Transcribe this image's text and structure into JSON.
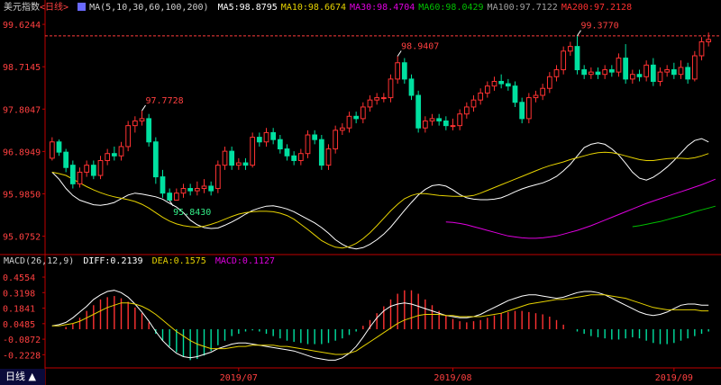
{
  "header": {
    "instrument": "美元指数",
    "period_tag": "<日线>",
    "ma_params": "MA(5,10,30,60,100,200)",
    "ma_values": [
      {
        "label": "MA5:98.8795",
        "color": "#ffffff"
      },
      {
        "label": "MA10:98.6674",
        "color": "#e6d200"
      },
      {
        "label": "MA30:98.4704",
        "color": "#e000e0"
      },
      {
        "label": "MA60:98.0429",
        "color": "#00c000"
      },
      {
        "label": "MA100:97.7122",
        "color": "#a0a0a0"
      },
      {
        "label": "MA200:97.2128",
        "color": "#ff3030"
      }
    ]
  },
  "macd_header": {
    "title": "MACD(26,12,9)",
    "diff": "DIFF:0.2139",
    "dea": "DEA:0.1575",
    "macd": "MACD:0.1127"
  },
  "period_button": "日线 ▲",
  "colors": {
    "up": "#ff3232",
    "down": "#00e0a0",
    "axis": "#c00000",
    "label": "#ff4040",
    "dash": "#ff3c3c"
  },
  "chart_data": [
    {
      "type": "candlestick",
      "y_ticks": [
        "99.6244",
        "98.7145",
        "97.8047",
        "96.8949",
        "95.9850",
        "95.0752"
      ],
      "ylim": [
        94.7,
        99.8
      ],
      "annotations": {
        "high1": "97.7728",
        "low1": "95.8430",
        "high2": "98.9407",
        "high3": "99.3770"
      },
      "resistance_line": 99.377,
      "x_labels": [
        "2019/07",
        "2019/08",
        "2019/09"
      ],
      "x_label_index": [
        27,
        58,
        90
      ],
      "candles": [
        [
          96.75,
          97.1,
          97.2,
          96.7
        ],
        [
          97.1,
          96.88,
          97.15,
          96.8
        ],
        [
          96.88,
          96.55,
          96.95,
          96.45
        ],
        [
          96.6,
          96.2,
          96.7,
          96.1
        ],
        [
          96.2,
          96.45,
          96.55,
          96.12
        ],
        [
          96.45,
          96.6,
          96.7,
          96.35
        ],
        [
          96.6,
          96.38,
          96.7,
          96.3
        ],
        [
          96.38,
          96.7,
          96.8,
          96.3
        ],
        [
          96.7,
          96.85,
          96.95,
          96.6
        ],
        [
          96.85,
          96.8,
          97.0,
          96.7
        ],
        [
          96.8,
          97.0,
          97.1,
          96.7
        ],
        [
          97.0,
          97.45,
          97.55,
          96.9
        ],
        [
          97.45,
          97.55,
          97.65,
          97.3
        ],
        [
          97.55,
          97.6,
          97.77,
          97.45
        ],
        [
          97.6,
          97.1,
          97.7,
          97.0
        ],
        [
          97.1,
          96.35,
          97.2,
          96.2
        ],
        [
          96.35,
          96.0,
          96.5,
          95.9
        ],
        [
          96.0,
          95.85,
          96.1,
          95.84
        ],
        [
          95.85,
          96.0,
          96.1,
          95.84
        ],
        [
          96.0,
          96.1,
          96.2,
          95.9
        ],
        [
          96.1,
          96.05,
          96.2,
          95.95
        ],
        [
          96.05,
          96.1,
          96.25,
          95.95
        ],
        [
          96.1,
          96.15,
          96.3,
          96.0
        ],
        [
          96.15,
          96.05,
          96.25,
          95.95
        ],
        [
          96.1,
          96.6,
          96.7,
          96.0
        ],
        [
          96.6,
          96.9,
          97.0,
          96.5
        ],
        [
          96.9,
          96.6,
          97.0,
          96.5
        ],
        [
          96.6,
          96.65,
          96.75,
          96.5
        ],
        [
          96.65,
          96.6,
          96.75,
          96.5
        ],
        [
          96.6,
          97.2,
          97.3,
          96.55
        ],
        [
          97.2,
          97.1,
          97.3,
          97.0
        ],
        [
          97.1,
          97.3,
          97.4,
          97.0
        ],
        [
          97.3,
          97.15,
          97.4,
          97.05
        ],
        [
          97.15,
          96.95,
          97.25,
          96.85
        ],
        [
          96.95,
          96.8,
          97.05,
          96.7
        ],
        [
          96.8,
          96.7,
          96.9,
          96.6
        ],
        [
          96.7,
          96.85,
          96.95,
          96.6
        ],
        [
          96.85,
          97.25,
          97.35,
          96.75
        ],
        [
          97.25,
          97.15,
          97.35,
          97.05
        ],
        [
          97.15,
          96.6,
          97.25,
          96.5
        ],
        [
          96.6,
          96.95,
          97.05,
          96.5
        ],
        [
          96.95,
          97.35,
          97.45,
          96.85
        ],
        [
          97.35,
          97.4,
          97.5,
          97.25
        ],
        [
          97.4,
          97.65,
          97.75,
          97.3
        ],
        [
          97.65,
          97.6,
          97.75,
          97.5
        ],
        [
          97.6,
          97.85,
          97.95,
          97.5
        ],
        [
          97.85,
          98.0,
          98.1,
          97.75
        ],
        [
          98.0,
          98.05,
          98.15,
          97.9
        ],
        [
          98.05,
          98.05,
          98.15,
          97.95
        ],
        [
          98.05,
          98.45,
          98.55,
          97.95
        ],
        [
          98.45,
          98.8,
          98.94,
          98.35
        ],
        [
          98.8,
          98.45,
          98.9,
          98.35
        ],
        [
          98.45,
          98.1,
          98.55,
          98.0
        ],
        [
          98.1,
          97.4,
          98.2,
          97.3
        ],
        [
          97.4,
          97.55,
          97.65,
          97.3
        ],
        [
          97.55,
          97.6,
          97.7,
          97.45
        ],
        [
          97.6,
          97.55,
          97.7,
          97.45
        ],
        [
          97.55,
          97.45,
          97.65,
          97.35
        ],
        [
          97.45,
          97.45,
          97.6,
          97.35
        ],
        [
          97.45,
          97.7,
          97.8,
          97.35
        ],
        [
          97.7,
          97.85,
          97.95,
          97.6
        ],
        [
          97.85,
          98.0,
          98.1,
          97.75
        ],
        [
          98.0,
          98.15,
          98.25,
          97.9
        ],
        [
          98.15,
          98.3,
          98.4,
          98.05
        ],
        [
          98.3,
          98.4,
          98.5,
          98.2
        ],
        [
          98.4,
          98.35,
          98.55,
          98.25
        ],
        [
          98.35,
          98.3,
          98.45,
          98.2
        ],
        [
          98.3,
          97.95,
          98.4,
          97.85
        ],
        [
          97.95,
          97.6,
          98.05,
          97.5
        ],
        [
          97.6,
          98.05,
          98.15,
          97.5
        ],
        [
          98.05,
          98.1,
          98.2,
          97.95
        ],
        [
          98.1,
          98.25,
          98.35,
          98.0
        ],
        [
          98.25,
          98.5,
          98.6,
          98.15
        ],
        [
          98.5,
          98.65,
          98.75,
          98.4
        ],
        [
          98.65,
          99.05,
          99.15,
          98.55
        ],
        [
          99.05,
          99.15,
          99.25,
          98.95
        ],
        [
          99.15,
          98.65,
          99.38,
          98.55
        ],
        [
          98.65,
          98.55,
          98.75,
          98.45
        ],
        [
          98.55,
          98.6,
          98.7,
          98.45
        ],
        [
          98.6,
          98.55,
          98.7,
          98.45
        ],
        [
          98.55,
          98.65,
          98.75,
          98.45
        ],
        [
          98.65,
          98.6,
          98.75,
          98.5
        ],
        [
          98.6,
          98.9,
          99.0,
          98.5
        ],
        [
          98.9,
          98.45,
          99.2,
          98.35
        ],
        [
          98.45,
          98.55,
          98.65,
          98.35
        ],
        [
          98.55,
          98.5,
          98.65,
          98.4
        ],
        [
          98.5,
          98.75,
          98.85,
          98.4
        ],
        [
          98.75,
          98.4,
          98.9,
          98.3
        ],
        [
          98.4,
          98.6,
          98.7,
          98.3
        ],
        [
          98.6,
          98.65,
          98.75,
          98.5
        ],
        [
          98.65,
          98.55,
          98.8,
          98.45
        ],
        [
          98.55,
          98.7,
          98.85,
          98.45
        ],
        [
          98.7,
          98.45,
          98.8,
          98.35
        ],
        [
          98.45,
          98.95,
          99.05,
          98.4
        ],
        [
          98.95,
          99.25,
          99.35,
          98.85
        ],
        [
          99.25,
          99.3,
          99.45,
          99.15
        ]
      ],
      "lines": {
        "ma5": [
          96.45,
          96.3,
          96.1,
          95.95,
          95.85,
          95.8,
          95.75,
          95.74,
          95.76,
          95.8,
          95.88,
          95.96,
          96.0,
          95.98,
          95.95,
          95.92,
          95.87,
          95.78,
          95.7,
          95.58,
          95.42,
          95.32,
          95.26,
          95.24,
          95.25,
          95.31,
          95.38,
          95.46,
          95.55,
          95.63,
          95.68,
          95.72,
          95.73,
          95.7,
          95.66,
          95.6,
          95.52,
          95.44,
          95.36,
          95.26,
          95.14,
          95.0,
          94.9,
          94.83,
          94.8,
          94.83,
          94.9,
          95.0,
          95.12,
          95.27,
          95.45,
          95.63,
          95.8,
          95.96,
          96.08,
          96.16,
          96.18,
          96.15,
          96.07,
          95.97,
          95.9,
          95.87,
          95.86,
          95.86,
          95.87,
          95.9,
          95.96,
          96.03,
          96.09,
          96.14,
          96.18,
          96.22,
          96.28,
          96.36,
          96.48,
          96.62,
          96.8,
          96.98,
          97.05,
          97.08,
          97.05,
          96.95,
          96.82,
          96.64,
          96.45,
          96.32,
          96.28,
          96.34,
          96.44,
          96.56,
          96.7,
          96.86,
          97.02,
          97.13,
          97.17,
          97.1
        ],
        "ma10": [
          96.45,
          96.42,
          96.38,
          96.3,
          96.22,
          96.14,
          96.07,
          96.01,
          95.96,
          95.92,
          95.89,
          95.86,
          95.82,
          95.76,
          95.68,
          95.58,
          95.48,
          95.4,
          95.34,
          95.3,
          95.28,
          95.27,
          95.29,
          95.33,
          95.38,
          95.44,
          95.5,
          95.55,
          95.58,
          95.6,
          95.61,
          95.61,
          95.6,
          95.57,
          95.52,
          95.44,
          95.33,
          95.22,
          95.1,
          94.98,
          94.9,
          94.84,
          94.82,
          94.85,
          94.92,
          95.02,
          95.15,
          95.3,
          95.46,
          95.62,
          95.76,
          95.88,
          95.95,
          95.99,
          95.99,
          95.97,
          95.95,
          95.94,
          95.93,
          95.93,
          95.93,
          95.95,
          96.0,
          96.06,
          96.12,
          96.18,
          96.24,
          96.3,
          96.36,
          96.42,
          96.48,
          96.54,
          96.59,
          96.63,
          96.67,
          96.72,
          96.76,
          96.8,
          96.84,
          96.87,
          96.88,
          96.87,
          96.84,
          96.8,
          96.76,
          96.72,
          96.7,
          96.7,
          96.72,
          96.74,
          96.75,
          96.75,
          96.74,
          96.76,
          96.8,
          96.85
        ]
      },
      "ma30_line": [
        95.38,
        95.37,
        95.35,
        95.32,
        95.28,
        95.24,
        95.2,
        95.16,
        95.12,
        95.08,
        95.06,
        95.04,
        95.03,
        95.03,
        95.04,
        95.06,
        95.08,
        95.12,
        95.16,
        95.2,
        95.25,
        95.3,
        95.36,
        95.42,
        95.48,
        95.54,
        95.6,
        95.66,
        95.72,
        95.78,
        95.83,
        95.88,
        95.93,
        95.98,
        96.03,
        96.08,
        96.13,
        96.18,
        96.24,
        96.3
      ],
      "ma60_line": [
        95.28,
        95.3,
        95.33,
        95.36,
        95.39,
        95.43,
        95.47,
        95.51,
        95.55,
        95.6,
        95.64,
        95.68,
        95.72
      ],
      "ma30_start_index": 57,
      "ma60_start_index": 84
    },
    {
      "type": "macd",
      "y_ticks": [
        "0.4554",
        "0.3198",
        "0.1841",
        "0.0485",
        "-0.0872",
        "-0.2228"
      ],
      "ylim": [
        -0.33,
        0.55
      ],
      "histogram": [
        0.0,
        0.0,
        0.02,
        0.05,
        0.1,
        0.16,
        0.21,
        0.26,
        0.28,
        0.29,
        0.27,
        0.24,
        0.19,
        0.14,
        0.06,
        -0.04,
        -0.1,
        -0.15,
        -0.2,
        -0.24,
        -0.27,
        -0.26,
        -0.23,
        -0.19,
        -0.14,
        -0.1,
        -0.06,
        -0.04,
        -0.02,
        -0.01,
        -0.02,
        -0.04,
        -0.06,
        -0.08,
        -0.1,
        -0.11,
        -0.12,
        -0.13,
        -0.13,
        -0.13,
        -0.12,
        -0.1,
        -0.08,
        -0.05,
        -0.02,
        0.03,
        0.08,
        0.14,
        0.2,
        0.26,
        0.31,
        0.34,
        0.34,
        0.31,
        0.26,
        0.21,
        0.16,
        0.12,
        0.09,
        0.07,
        0.06,
        0.07,
        0.08,
        0.1,
        0.12,
        0.14,
        0.15,
        0.16,
        0.16,
        0.15,
        0.14,
        0.13,
        0.11,
        0.08,
        0.04,
        0.0,
        -0.02,
        -0.04,
        -0.06,
        -0.07,
        -0.08,
        -0.09,
        -0.09,
        -0.08,
        -0.07,
        -0.08,
        -0.1,
        -0.12,
        -0.13,
        -0.13,
        -0.12,
        -0.1,
        -0.08,
        -0.06,
        -0.04,
        -0.02
      ],
      "diff": [
        0.03,
        0.04,
        0.06,
        0.1,
        0.15,
        0.2,
        0.26,
        0.3,
        0.33,
        0.34,
        0.32,
        0.28,
        0.22,
        0.15,
        0.07,
        -0.02,
        -0.1,
        -0.16,
        -0.21,
        -0.24,
        -0.25,
        -0.24,
        -0.22,
        -0.2,
        -0.17,
        -0.15,
        -0.13,
        -0.12,
        -0.12,
        -0.13,
        -0.14,
        -0.15,
        -0.16,
        -0.17,
        -0.18,
        -0.19,
        -0.21,
        -0.23,
        -0.25,
        -0.26,
        -0.27,
        -0.27,
        -0.25,
        -0.21,
        -0.15,
        -0.07,
        0.02,
        0.1,
        0.16,
        0.2,
        0.22,
        0.23,
        0.22,
        0.2,
        0.18,
        0.16,
        0.14,
        0.12,
        0.11,
        0.1,
        0.1,
        0.11,
        0.13,
        0.16,
        0.19,
        0.22,
        0.25,
        0.27,
        0.29,
        0.3,
        0.3,
        0.29,
        0.28,
        0.27,
        0.28,
        0.3,
        0.32,
        0.33,
        0.33,
        0.32,
        0.3,
        0.27,
        0.24,
        0.21,
        0.18,
        0.15,
        0.13,
        0.12,
        0.13,
        0.15,
        0.18,
        0.21,
        0.22,
        0.22,
        0.21,
        0.21
      ],
      "dea": [
        0.03,
        0.03,
        0.04,
        0.05,
        0.07,
        0.1,
        0.13,
        0.16,
        0.19,
        0.21,
        0.23,
        0.23,
        0.22,
        0.2,
        0.17,
        0.13,
        0.08,
        0.03,
        -0.02,
        -0.06,
        -0.1,
        -0.13,
        -0.15,
        -0.17,
        -0.17,
        -0.17,
        -0.16,
        -0.15,
        -0.15,
        -0.14,
        -0.14,
        -0.14,
        -0.14,
        -0.15,
        -0.15,
        -0.16,
        -0.17,
        -0.18,
        -0.19,
        -0.2,
        -0.21,
        -0.22,
        -0.22,
        -0.21,
        -0.19,
        -0.15,
        -0.11,
        -0.07,
        -0.03,
        0.01,
        0.05,
        0.08,
        0.1,
        0.12,
        0.13,
        0.13,
        0.13,
        0.12,
        0.12,
        0.11,
        0.11,
        0.11,
        0.11,
        0.12,
        0.13,
        0.14,
        0.16,
        0.18,
        0.2,
        0.22,
        0.23,
        0.24,
        0.25,
        0.26,
        0.26,
        0.27,
        0.28,
        0.29,
        0.3,
        0.3,
        0.3,
        0.29,
        0.28,
        0.27,
        0.25,
        0.23,
        0.21,
        0.19,
        0.18,
        0.17,
        0.17,
        0.17,
        0.17,
        0.17,
        0.16,
        0.16
      ]
    }
  ]
}
